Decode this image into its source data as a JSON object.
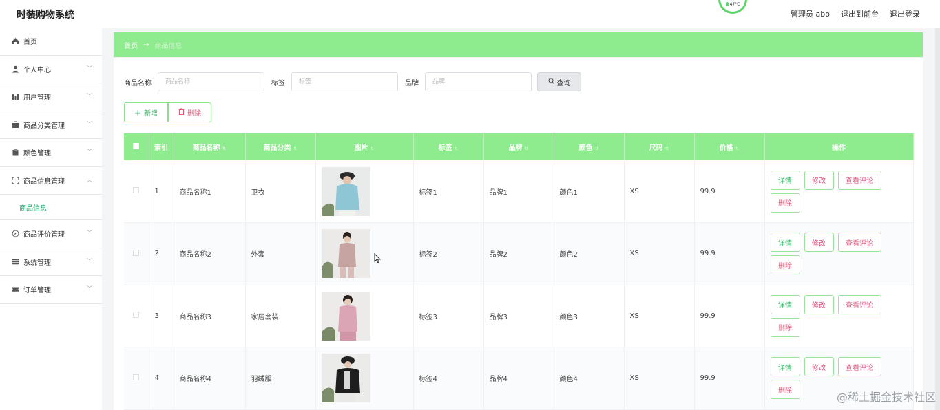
{
  "header": {
    "title": "时装购物系统",
    "weather": "47°C",
    "user": "管理员 abo",
    "back_to_front": "退出到前台",
    "logout": "退出登录"
  },
  "sidebar": {
    "items": [
      {
        "label": "首页",
        "icon": "home-icon",
        "chevron": false
      },
      {
        "label": "个人中心",
        "icon": "user-icon",
        "chevron": true
      },
      {
        "label": "用户管理",
        "icon": "chart-icon",
        "chevron": true
      },
      {
        "label": "商品分类管理",
        "icon": "briefcase-icon",
        "chevron": true
      },
      {
        "label": "颜色管理",
        "icon": "clipboard-icon",
        "chevron": true
      },
      {
        "label": "商品信息管理",
        "icon": "frame-icon",
        "chevron": true,
        "expanded": true
      }
    ],
    "active_submenu": "商品信息",
    "items_after": [
      {
        "label": "商品评价管理",
        "icon": "compass-icon",
        "chevron": true
      },
      {
        "label": "系统管理",
        "icon": "list-icon",
        "chevron": true
      },
      {
        "label": "订单管理",
        "icon": "ticket-icon",
        "chevron": true
      }
    ]
  },
  "breadcrumb": {
    "home": "首页",
    "separator": "→",
    "current": "商品信息"
  },
  "search": {
    "name_label": "商品名称",
    "name_placeholder": "商品名称",
    "tag_label": "标签",
    "tag_placeholder": "标签",
    "brand_label": "品牌",
    "brand_placeholder": "品牌",
    "query_button": "查询"
  },
  "actions": {
    "add": "新增",
    "delete": "删除"
  },
  "table": {
    "headers": [
      "索引",
      "商品名称",
      "商品分类",
      "图片",
      "标签",
      "品牌",
      "颜色",
      "尺码",
      "价格",
      "操作"
    ],
    "rows": [
      {
        "index": "1",
        "name": "商品名称1",
        "category": "卫衣",
        "tag": "标签1",
        "brand": "品牌1",
        "color": "颜色1",
        "size": "XS",
        "price": "99.9"
      },
      {
        "index": "2",
        "name": "商品名称2",
        "category": "外套",
        "tag": "标签2",
        "brand": "品牌2",
        "color": "颜色2",
        "size": "XS",
        "price": "99.9"
      },
      {
        "index": "3",
        "name": "商品名称3",
        "category": "家居套装",
        "tag": "标签3",
        "brand": "品牌3",
        "color": "颜色3",
        "size": "XS",
        "price": "99.9"
      },
      {
        "index": "4",
        "name": "商品名称4",
        "category": "羽绒服",
        "tag": "标签4",
        "brand": "品牌4",
        "color": "颜色4",
        "size": "XS",
        "price": "99.9"
      }
    ],
    "op_labels": {
      "detail": "详情",
      "edit": "修改",
      "review": "查看评论",
      "remove": "删除"
    }
  },
  "watermark": "@稀土掘金技术社区",
  "colors": {
    "accent_green": "#8eec8e",
    "link_green": "#1aa86a",
    "danger_pink": "#e05a7a"
  }
}
